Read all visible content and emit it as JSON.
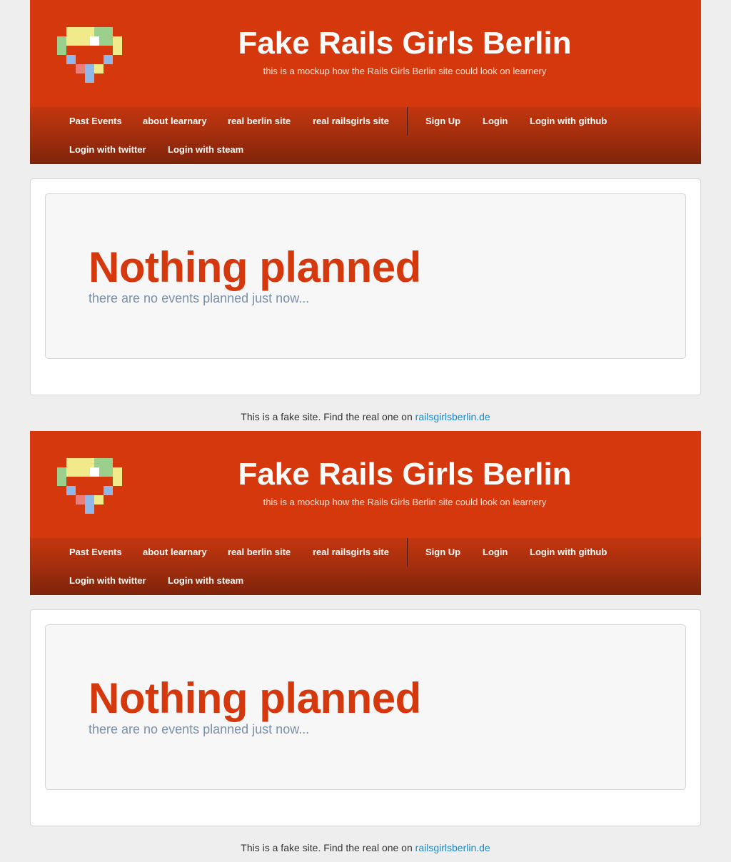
{
  "header": {
    "title": "Fake Rails Girls Berlin",
    "tagline": "this is a mockup how the Rails Girls Berlin site could look on learnery"
  },
  "logo": {
    "icon": "pixel-heart-icon",
    "colors": [
      "#f1ea8a",
      "#9bd08c",
      "#ffffff",
      "#8fb7e8",
      "#ea7f7a"
    ]
  },
  "nav": {
    "past_events": "Past Events",
    "about": "about learnary",
    "real_berlin": "real berlin site",
    "real_railsgirls": "real railsgirls site",
    "sign_up": "Sign Up",
    "login": "Login",
    "login_github": "Login with github",
    "login_twitter": "Login with twitter",
    "login_steam": "Login with steam"
  },
  "hero": {
    "title": "Nothing planned",
    "subtitle": "there are no events planned just now..."
  },
  "footer": {
    "text": "This is a fake site. Find the real one on ",
    "link_text": "railsgirlsberlin.de"
  },
  "colors": {
    "brand": "#d5380d",
    "link": "#1a88c9",
    "subtitle": "#7a8fa8",
    "background": "#eeeeee"
  }
}
